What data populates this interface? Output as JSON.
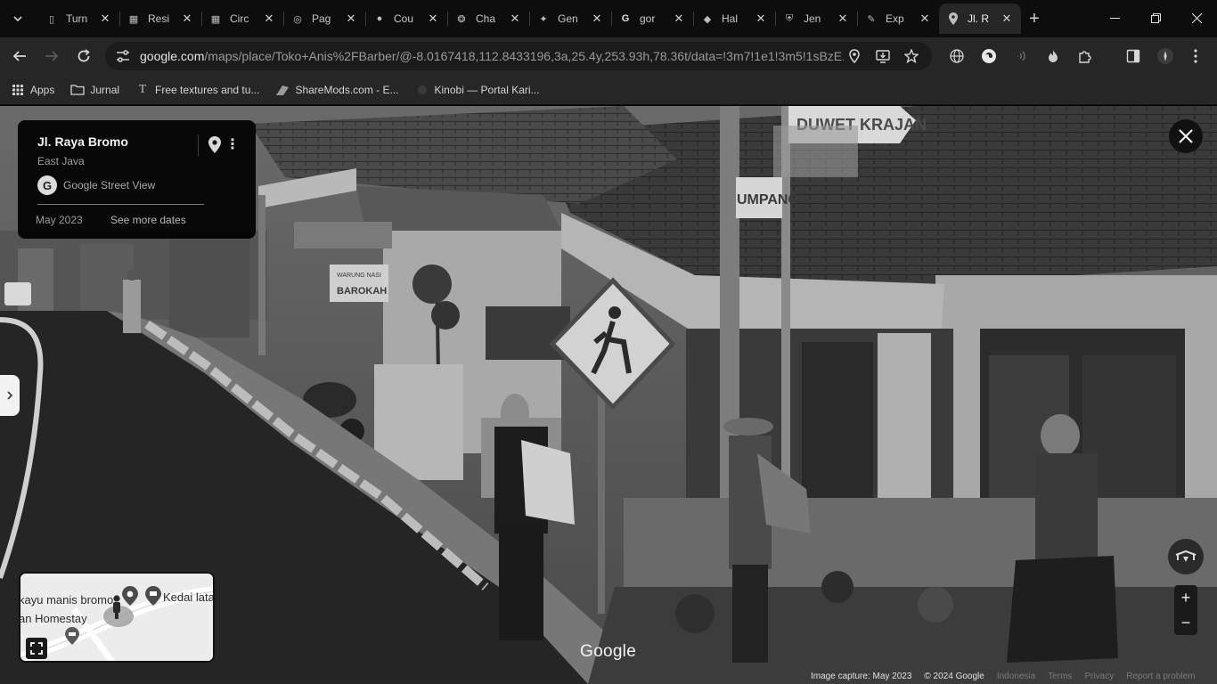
{
  "tabs": [
    {
      "title": "Turn",
      "favicon": "page-icon"
    },
    {
      "title": "Resi",
      "favicon": "qr-icon"
    },
    {
      "title": "Circ",
      "favicon": "qr-icon"
    },
    {
      "title": "Pag",
      "favicon": "instagram-icon"
    },
    {
      "title": "Cou",
      "favicon": "circle-icon"
    },
    {
      "title": "Cha",
      "favicon": "openai-icon"
    },
    {
      "title": "Gen",
      "favicon": "sparkle-icon"
    },
    {
      "title": "gor",
      "favicon": "google-icon"
    },
    {
      "title": "Hal",
      "favicon": "page-icon"
    },
    {
      "title": "Jen",
      "favicon": "shield-icon"
    },
    {
      "title": "Exp",
      "favicon": "puzzle-icon"
    },
    {
      "title": "Jl. R",
      "favicon": "maps-pin-icon",
      "active": true
    }
  ],
  "url": {
    "host": "google.com",
    "path": "/maps/place/Toko+Anis%2FBarber/@-8.0167418,112.8433196,3a,25.4y,253.93h,78.36t/data=!3m7!1e1!3m5!1sBzE..."
  },
  "bookmarks": [
    {
      "label": "Apps",
      "icon": "grid-icon"
    },
    {
      "label": "Jurnal",
      "icon": "folder-icon"
    },
    {
      "label": "Free textures and tu...",
      "icon": "texture-icon"
    },
    {
      "label": "ShareMods.com - E...",
      "icon": "sharemods-icon"
    },
    {
      "label": "Kinobi — Portal Kari...",
      "icon": "kinobi-icon"
    }
  ],
  "info_card": {
    "title": "Jl. Raya Bromo",
    "subtitle": "East Java",
    "source": "Google Street View",
    "date": "May 2023",
    "more_dates": "See more dates"
  },
  "scene_signs": {
    "street_sign_top": "DUWET KRAJAN",
    "street_sign_bottom": "UMPANG",
    "shop_sign_line1": "WARUNG NASI",
    "shop_sign_line2": "BAROKAH"
  },
  "minimap": {
    "label_1": "kayu manis bromo",
    "label_2": "an Homestay",
    "label_3": "Kedai lata"
  },
  "watermark": "Google",
  "footer": {
    "capture": "Image capture: May 2023",
    "copyright": "© 2024 Google",
    "country": "Indonesia",
    "terms": "Terms",
    "privacy": "Privacy",
    "report": "Report a problem"
  }
}
